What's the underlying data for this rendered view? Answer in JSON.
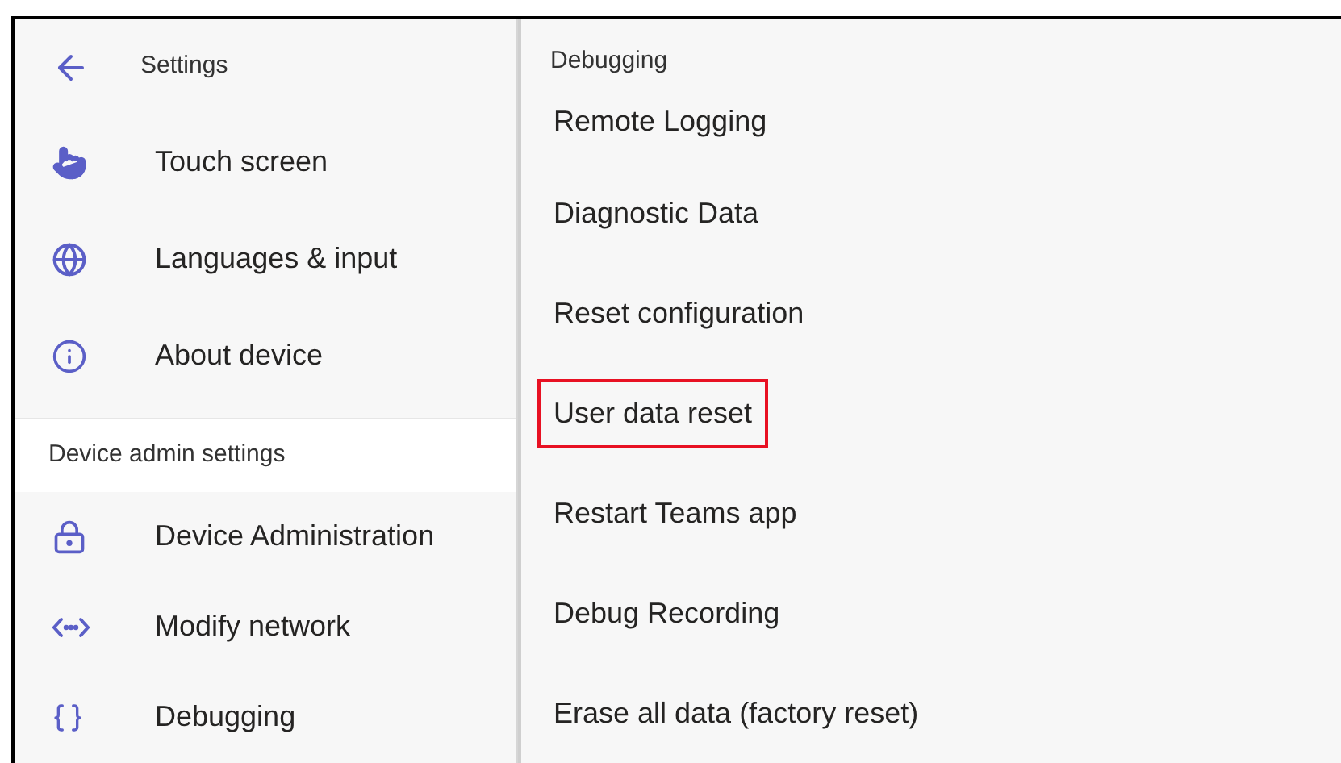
{
  "sidebar": {
    "back_title": "Settings",
    "items": [
      {
        "kind": "touch",
        "label": "Touch screen"
      },
      {
        "kind": "globe",
        "label": "Languages & input"
      },
      {
        "kind": "info",
        "label": "About device"
      }
    ],
    "section": "Device admin settings",
    "admin_items": [
      {
        "kind": "lock",
        "label": "Device Administration"
      },
      {
        "kind": "network",
        "label": "Modify network"
      },
      {
        "kind": "braces",
        "label": "Debugging"
      }
    ]
  },
  "content": {
    "title": "Debugging",
    "items": [
      {
        "label": "Remote Logging",
        "selected": false
      },
      {
        "label": "Diagnostic Data",
        "selected": false
      },
      {
        "label": "Reset configuration",
        "selected": false
      },
      {
        "label": "User data reset",
        "selected": true
      },
      {
        "label": "Restart Teams app",
        "selected": false
      },
      {
        "label": "Debug Recording",
        "selected": false
      },
      {
        "label": "Erase all data (factory reset)",
        "selected": false
      }
    ]
  }
}
